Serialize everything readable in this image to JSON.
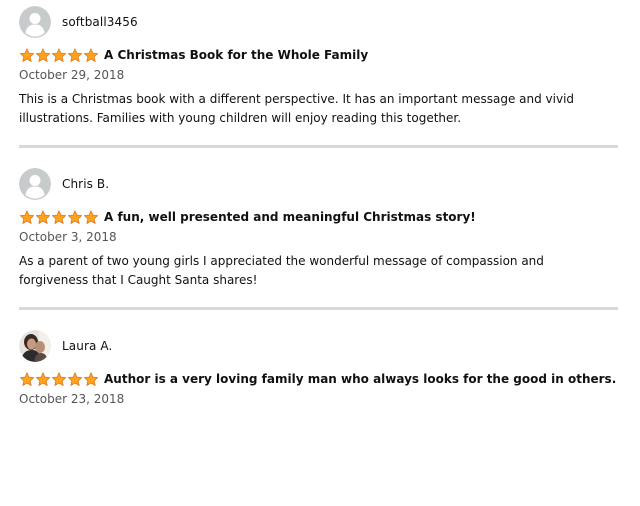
{
  "reviews": [
    {
      "reviewer": "softball3456",
      "avatar": "default-avatar",
      "rating": 5,
      "title": "A Christmas Book for the Whole Family",
      "date": "October 29, 2018",
      "body": "This is a Christmas book with a different perspective. It has an important message and vivid illustrations. Families with young children will enjoy reading this together."
    },
    {
      "reviewer": "Chris B.",
      "avatar": "default-avatar",
      "rating": 5,
      "title": "A fun, well presented and meaningful Christmas story!",
      "date": "October 3, 2018",
      "body": "As a parent of two young girls I appreciated the wonderful message of compassion and forgiveness that I Caught Santa shares!"
    },
    {
      "reviewer": "Laura A.",
      "avatar": "photo-avatar",
      "rating": 5,
      "title": "Author is a very loving family man who always looks for the good in others.",
      "date": "October 23, 2018",
      "body": ""
    }
  ],
  "colors": {
    "star": "#ffa41c",
    "star_stroke": "#de7921",
    "divider": "#d5d9d9",
    "avatar_bg": "#c7cbcc",
    "avatar_fg": "#ffffff"
  }
}
